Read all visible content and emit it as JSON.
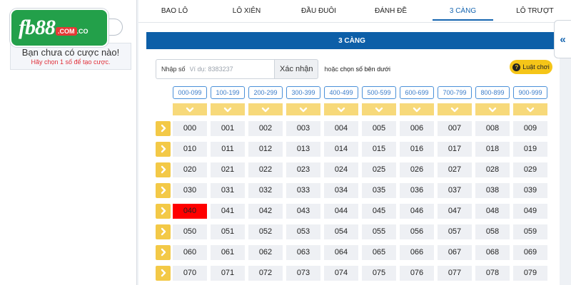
{
  "logo": {
    "main": "fb88",
    "dot": ".COM",
    "tld": ".CO"
  },
  "bet_slip": {
    "empty_text": "Bạn chưa có cược nào!",
    "hint": "Hãy chọn 1 số để tạo cược."
  },
  "tabs": [
    {
      "label": "BAO LÔ",
      "active": false
    },
    {
      "label": "LÔ XIÊN",
      "active": false
    },
    {
      "label": "ĐẦU ĐUÔI",
      "active": false
    },
    {
      "label": "ĐÁNH ĐỀ",
      "active": false
    },
    {
      "label": "3 CÀNG",
      "active": true
    },
    {
      "label": "LÔ TRƯỢT",
      "active": false
    }
  ],
  "panel": {
    "title": "3 CÀNG"
  },
  "number_input": {
    "label": "Nhập số",
    "placeholder": "Ví dụ: 8383237",
    "value": ""
  },
  "confirm_button": "Xác nhận",
  "or_text_prefix": "hoặc",
  "or_text_emphasis": "chọn số bên dưới",
  "rules_button": "Luật chơi",
  "collapse_icon": "«",
  "ranges": [
    "000-099",
    "100-199",
    "200-299",
    "300-399",
    "400-499",
    "500-599",
    "600-699",
    "700-799",
    "800-899",
    "900-999"
  ],
  "grid_rows": [
    [
      "000",
      "001",
      "002",
      "003",
      "004",
      "005",
      "006",
      "007",
      "008",
      "009"
    ],
    [
      "010",
      "011",
      "012",
      "013",
      "014",
      "015",
      "016",
      "017",
      "018",
      "019"
    ],
    [
      "020",
      "021",
      "022",
      "023",
      "024",
      "025",
      "026",
      "027",
      "028",
      "029"
    ],
    [
      "030",
      "031",
      "032",
      "033",
      "034",
      "035",
      "036",
      "037",
      "038",
      "039"
    ],
    [
      "040",
      "041",
      "042",
      "043",
      "044",
      "045",
      "046",
      "047",
      "048",
      "049"
    ],
    [
      "050",
      "051",
      "052",
      "053",
      "054",
      "055",
      "056",
      "057",
      "058",
      "059"
    ],
    [
      "060",
      "061",
      "062",
      "063",
      "064",
      "065",
      "066",
      "067",
      "068",
      "069"
    ],
    [
      "070",
      "071",
      "072",
      "073",
      "074",
      "075",
      "076",
      "077",
      "078",
      "079"
    ]
  ],
  "selected_number": "040",
  "colors": {
    "accent": "#1565b0",
    "header": "#0d5fa8",
    "highlight": "#ff0000",
    "yellow": "#f3c947"
  }
}
